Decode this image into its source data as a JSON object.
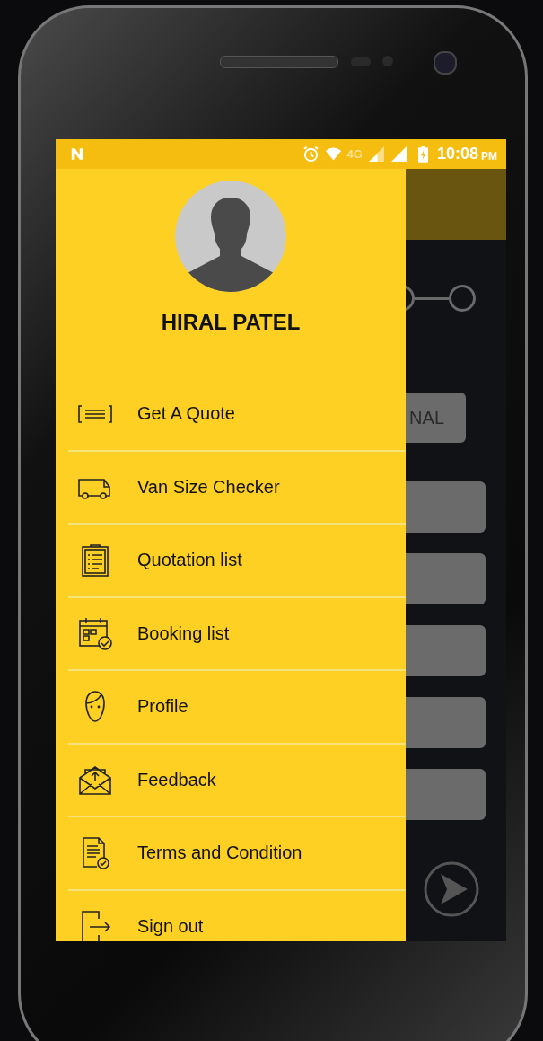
{
  "status_bar": {
    "network": "4G",
    "time": "10:08",
    "period": "PM"
  },
  "drawer": {
    "user_name": "HIRAL PATEL",
    "items": [
      {
        "kind": "quote",
        "label": "Get A Quote"
      },
      {
        "kind": "van",
        "label": "Van Size Checker"
      },
      {
        "kind": "clipboard",
        "label": "Quotation list"
      },
      {
        "kind": "calendar",
        "label": "Booking list"
      },
      {
        "kind": "face",
        "label": "Profile"
      },
      {
        "kind": "envelope",
        "label": "Feedback"
      },
      {
        "kind": "document",
        "label": "Terms and Condition"
      },
      {
        "kind": "signout",
        "label": "Sign out"
      }
    ]
  },
  "background_screen": {
    "option_button": "NAL"
  }
}
